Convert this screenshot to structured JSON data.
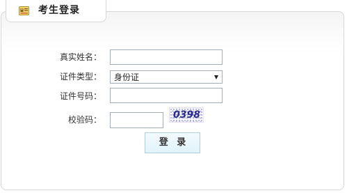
{
  "panel": {
    "title": "考生登录",
    "icon": "id-card-icon"
  },
  "form": {
    "real_name": {
      "label": "真实姓名：",
      "value": ""
    },
    "id_type": {
      "label": "证件类型：",
      "selected": "身份证"
    },
    "id_number": {
      "label": "证件号码：",
      "value": ""
    },
    "captcha": {
      "label": "校验码：",
      "value": "",
      "image_text": "0398"
    },
    "submit_label": "登 录"
  }
}
